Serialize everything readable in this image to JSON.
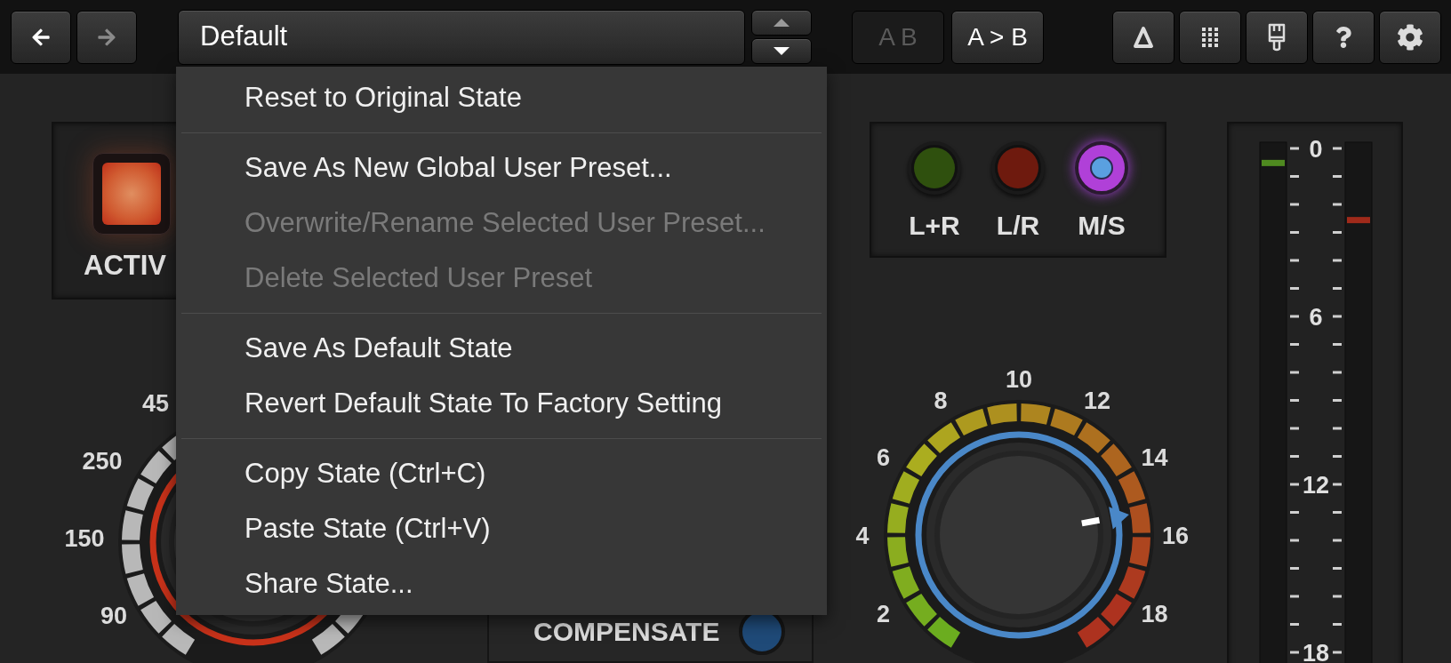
{
  "toolbar": {
    "back": {
      "disabled": false
    },
    "forward": {
      "disabled": true
    },
    "preset": "Default",
    "preset_up": {
      "disabled": true
    },
    "preset_down": {
      "disabled": false
    },
    "ab_buttons": [
      {
        "label": "A B",
        "disabled": true
      },
      {
        "label": "A > B",
        "disabled": false
      }
    ]
  },
  "preset_menu": {
    "groups": [
      [
        {
          "label": "Reset to Original State",
          "disabled": false
        }
      ],
      [
        {
          "label": "Save As New Global User Preset...",
          "disabled": false
        },
        {
          "label": "Overwrite/Rename Selected User Preset...",
          "disabled": true
        },
        {
          "label": "Delete Selected User Preset",
          "disabled": true
        }
      ],
      [
        {
          "label": "Save As Default State",
          "disabled": false
        },
        {
          "label": "Revert Default State To Factory Setting",
          "disabled": false
        }
      ],
      [
        {
          "label": "Copy State (Ctrl+C)",
          "disabled": false
        },
        {
          "label": "Paste State (Ctrl+V)",
          "disabled": false
        },
        {
          "label": "Share State...",
          "disabled": false
        }
      ]
    ]
  },
  "active": {
    "label": "ACTIV",
    "on": true
  },
  "input_knob": {
    "labels": [
      "45",
      "250",
      "150",
      "90"
    ]
  },
  "compensate": {
    "label": "COMPENSATE",
    "on": false
  },
  "modes": [
    {
      "label": "L+R",
      "color": "#2f500e",
      "selected": false
    },
    {
      "label": "L/R",
      "color": "#6e1a0e",
      "selected": false
    },
    {
      "label": "M/S",
      "color": "#5aa0e0",
      "selected": true
    }
  ],
  "gain_knob": {
    "labels": [
      "2",
      "4",
      "6",
      "8",
      "10",
      "12",
      "14",
      "16",
      "18"
    ],
    "level": 0.765
  },
  "meter": {
    "scale": [
      "0",
      "6",
      "12",
      "18"
    ],
    "channels": [
      {
        "color": "#4f8a20",
        "level": 0.979
      },
      {
        "color": "#a02a1a",
        "level": 0.894
      }
    ]
  }
}
